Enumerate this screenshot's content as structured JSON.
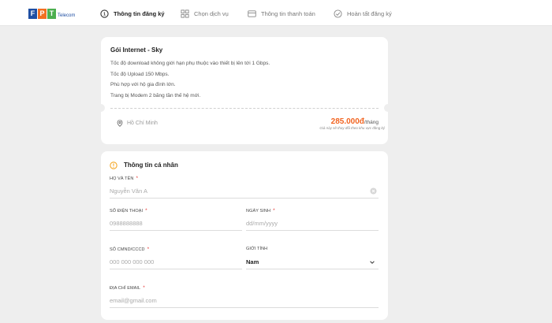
{
  "header": {
    "logo_letters": [
      "F",
      "P",
      "T"
    ],
    "logo_sub": "Telecom",
    "steps": [
      {
        "label": "Thông tin đăng ký",
        "icon": "circle-one-icon",
        "active": true
      },
      {
        "label": "Chọn dịch vụ",
        "icon": "grid-icon",
        "active": false
      },
      {
        "label": "Thông tin thanh toán",
        "icon": "card-icon",
        "active": false
      },
      {
        "label": "Hoàn tất đăng ký",
        "icon": "check-circle-icon",
        "active": false
      }
    ]
  },
  "package": {
    "title": "Gói Internet - Sky",
    "features": [
      "Tốc độ download không giới hạn phụ thuộc vào thiết bị lên tới 1 Gbps.",
      "Tốc độ Upload 150 Mbps.",
      "Phù hợp với hộ gia đình lớn.",
      "Trang bị Modem 2 băng tần thế hệ mới."
    ],
    "location": "Hồ Chí Minh",
    "price": "285.000đ",
    "price_unit": "/tháng",
    "price_note": "Giá này sẽ thay đổi theo khu vực đăng ký"
  },
  "form": {
    "section_title": "Thông tin cá nhân",
    "fullname": {
      "label": "HỌ VÀ TÊN",
      "placeholder": "Nguyễn Văn A"
    },
    "phone": {
      "label": "SỐ ĐIỆN THOẠI",
      "placeholder": "0988888888"
    },
    "dob": {
      "label": "NGÀY SINH",
      "placeholder": "dd/mm/yyyy"
    },
    "idcard": {
      "label": "SỐ CMND/CCCD",
      "placeholder": "000 000 000 000"
    },
    "gender": {
      "label": "GIỚI TÍNH",
      "value": "Nam"
    },
    "email": {
      "label": "ĐỊA CHỈ EMAIL",
      "placeholder": "email@gmail.com"
    }
  },
  "colors": {
    "logo_blue": "#1f4fa3",
    "logo_orange": "#f37021",
    "logo_green": "#4caf50",
    "price_orange": "#f26522",
    "required_red": "#e53935",
    "section_icon_orange": "#f5a623"
  }
}
